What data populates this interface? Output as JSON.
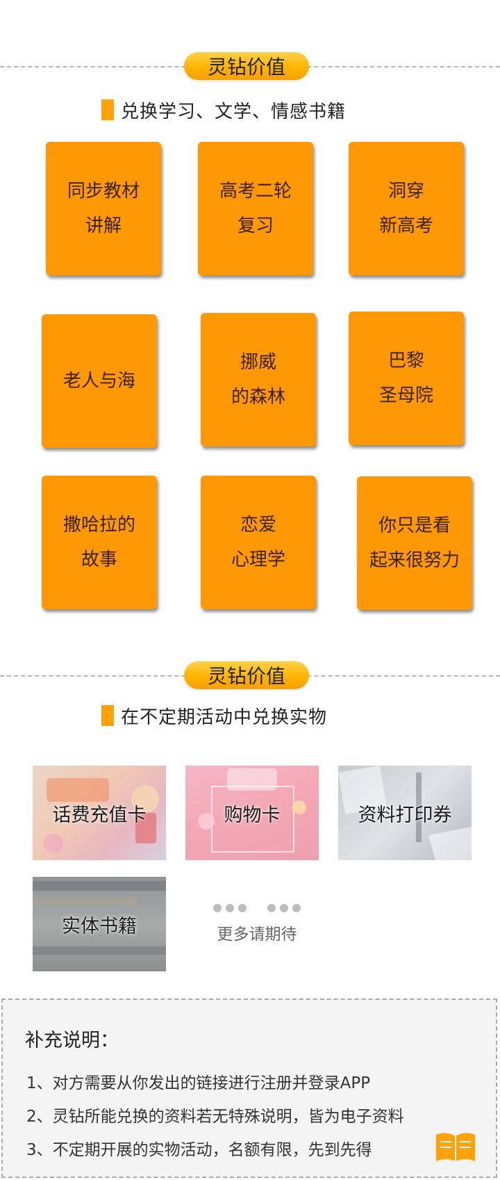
{
  "section1": {
    "badge": "灵钻价值",
    "subheading": "兑换学习、文学、情感书籍",
    "books": [
      {
        "line1": "同步教材",
        "line2": "讲解"
      },
      {
        "line1": "高考二轮",
        "line2": "复习"
      },
      {
        "line1": "洞穿",
        "line2": "新高考"
      },
      {
        "line1": "老人与海",
        "line2": ""
      },
      {
        "line1": "挪威",
        "line2": "的森林"
      },
      {
        "line1": "巴黎",
        "line2": "圣母院"
      },
      {
        "line1": "撒哈拉的",
        "line2": "故事"
      },
      {
        "line1": "恋爱",
        "line2": "心理学"
      },
      {
        "line1": "你只是看",
        "line2": "起来很努力"
      }
    ]
  },
  "section2": {
    "badge": "灵钻价值",
    "subheading": "在不定期活动中兑换实物",
    "tiles": [
      {
        "label": "话费充值卡"
      },
      {
        "label": "购物卡"
      },
      {
        "label": "资料打印券"
      },
      {
        "label": "实体书籍"
      }
    ],
    "more": "更多请期待"
  },
  "notes": {
    "title": "补充说明：",
    "items": [
      "1、对方需要从你发出的链接进行注册并登录APP",
      "2、灵钻所能兑换的资料若无特殊说明，皆为电子资料",
      "3、不定期开展的实物活动，名额有限，先到先得"
    ]
  },
  "colors": {
    "accent_orange": "#ff9805",
    "badge_gold": "#ffb400",
    "text_dark": "#222222"
  },
  "icons": {
    "book": "open-book-icon"
  }
}
